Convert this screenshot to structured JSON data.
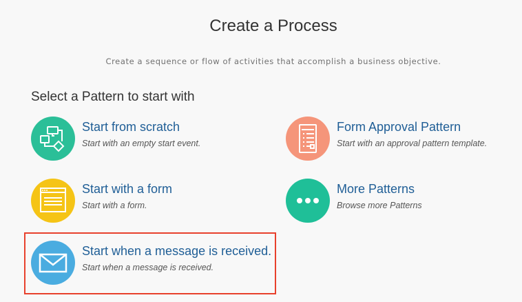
{
  "header": {
    "title": "Create a Process",
    "subtitle": "Create a sequence or flow of activities that accomplish a business objective."
  },
  "section": {
    "heading": "Select a Pattern to start with"
  },
  "options": {
    "scratch": {
      "label": "Start from scratch",
      "description": "Start with an empty start event.",
      "icon": "flowchart-icon",
      "color": "#2bbf98"
    },
    "form_approval": {
      "label": "Form Approval Pattern",
      "description": "Start with an approval pattern template.",
      "icon": "form-document-icon",
      "color": "#f5957a"
    },
    "form": {
      "label": "Start with a form",
      "description": "Start with a form.",
      "icon": "form-window-icon",
      "color": "#f5c416"
    },
    "more": {
      "label": "More Patterns",
      "description": "Browse more Patterns",
      "icon": "more-dots-icon",
      "color": "#1fbf98"
    },
    "message": {
      "label": "Start when a message is received.",
      "description": "Start when a message is received.",
      "icon": "envelope-icon",
      "color": "#4aace0"
    }
  },
  "highlight_color": "#e8402c"
}
